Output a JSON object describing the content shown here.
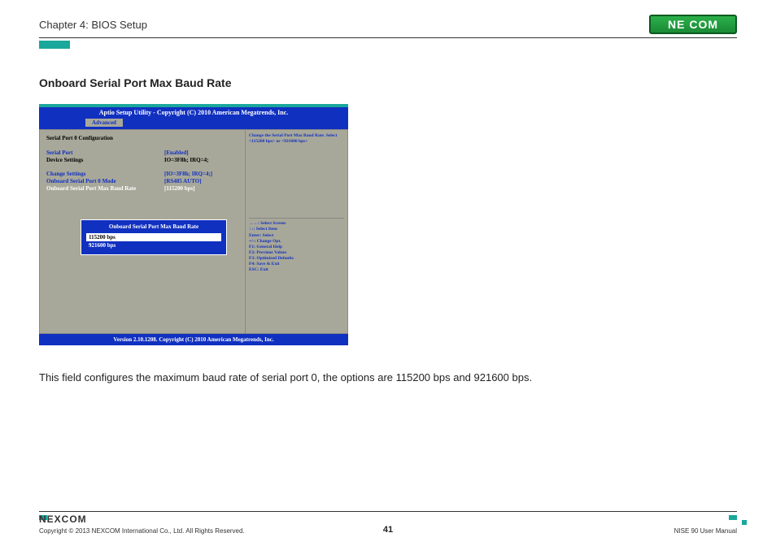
{
  "header": {
    "chapter": "Chapter 4: BIOS Setup",
    "logo_text": "NE COM"
  },
  "section_title": "Onboard Serial Port Max Baud Rate",
  "bios": {
    "titlebar": "Aptio Setup Utility - Copyright (C) 2010 American Megatrends, Inc.",
    "tab": "Advanced",
    "config_header": "Serial Port 0 Configuration",
    "rows": [
      {
        "label": "Serial Port",
        "value": "[Enabled]",
        "lbl_cls": "blue",
        "val_cls": "blue"
      },
      {
        "label": "Device Settings",
        "value": "IO=3F8h; IRQ=4;",
        "lbl_cls": "black",
        "val_cls": "black"
      }
    ],
    "rows2": [
      {
        "label": "Change Settings",
        "value": "[IO=3F8h; IRQ=4;]",
        "lbl_cls": "blue",
        "val_cls": "blue"
      },
      {
        "label": "Onboard Serial Port 0 Mode",
        "value": "[RS485 AUTO]",
        "lbl_cls": "blue",
        "val_cls": "blue"
      },
      {
        "label": "Onboard Serial Port Max Baud Rate",
        "value": "[115200 bps]",
        "lbl_cls": "white",
        "val_cls": "white"
      }
    ],
    "popup": {
      "title": "Onboard Serial Port Max Baud Rate",
      "options": [
        {
          "text": "115200 bps",
          "selected": true
        },
        {
          "text": "921600 bps",
          "selected": false
        }
      ]
    },
    "help_top": "Change the Serial Port Max Baud Rate. Select <115200 bps> or <921600 bps>",
    "help_keys": [
      "→←: Select Screen",
      "↑↓: Select Item",
      "Enter: Select",
      "+/-: Change Opt.",
      "F1: General Help",
      "F2: Previous Values",
      "F3: Optimized Defaults",
      "F4: Save & Exit",
      "ESC: Exit"
    ],
    "footer": "Version 2.10.1208. Copyright (C) 2010 American Megatrends, Inc."
  },
  "description": "This field configures the maximum baud rate of serial port 0, the options are 115200 bps and 921600 bps.",
  "footer": {
    "logo": "NEXCOM",
    "copyright": "Copyright © 2013 NEXCOM International Co., Ltd. All Rights Reserved.",
    "page": "41",
    "manual": "NISE 90 User Manual"
  }
}
